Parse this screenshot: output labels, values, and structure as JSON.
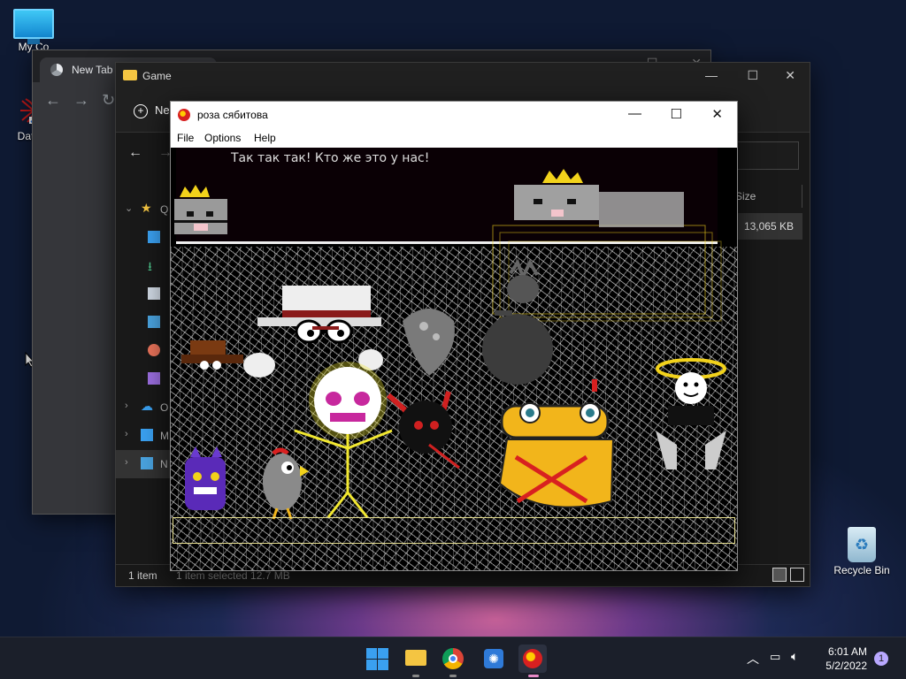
{
  "desktop": {
    "icons": [
      {
        "label": "My Co"
      },
      {
        "label": "DataW"
      },
      {
        "label": "Recycle Bin"
      }
    ]
  },
  "chrome": {
    "tab_title": "New Tab"
  },
  "explorer": {
    "title": "Game",
    "new_label": "Ne",
    "sidebar": [
      {
        "label": "Q"
      },
      {
        "label": ""
      },
      {
        "label": ""
      },
      {
        "label": ""
      },
      {
        "label": ""
      },
      {
        "label": ""
      },
      {
        "label": ""
      },
      {
        "label": "O"
      },
      {
        "label": "M"
      },
      {
        "label": "N"
      }
    ],
    "column_size": "Size",
    "row_size": "13,065 KB",
    "status_count": "1 item",
    "status_selected": "1 item selected  12.7 MB"
  },
  "game": {
    "title": "роза сябитова",
    "menu": [
      "File",
      "Options",
      "Help"
    ],
    "dialog": "Так так так! Кто же это у нас!"
  },
  "taskbar": {
    "time": "6:01 AM",
    "date": "5/2/2022",
    "notifications": "1"
  },
  "colors": {
    "accent": "#3aa0f0",
    "folder": "#f4c542",
    "game_yellow": "#f2d21b"
  }
}
